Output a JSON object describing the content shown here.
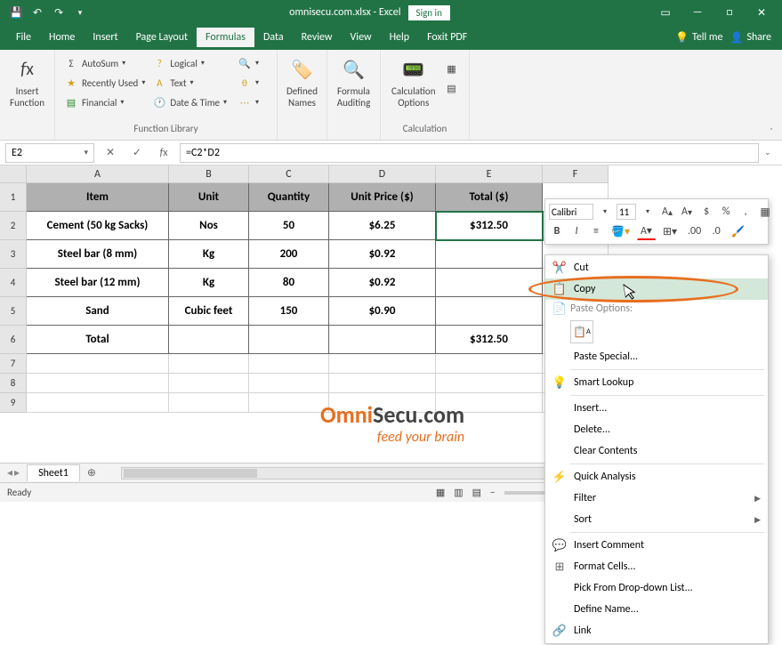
{
  "title": "omnisecu.com.xlsx - Excel",
  "signin": "Sign in",
  "tabs": [
    "File",
    "Home",
    "Insert",
    "Page Layout",
    "Formulas",
    "Data",
    "Review",
    "View",
    "Help",
    "Foxit PDF"
  ],
  "tellme": "Tell me",
  "share": "Share",
  "ribbon": {
    "insert_fn": "Insert\nFunction",
    "autosum": "AutoSum",
    "recent": "Recently Used",
    "financial": "Financial",
    "logical": "Logical",
    "text": "Text",
    "datetime": "Date & Time",
    "defnames": "Defined\nNames",
    "auditing": "Formula\nAuditing",
    "calcopt": "Calculation\nOptions",
    "group_lib": "Function Library",
    "group_calc": "Calculation"
  },
  "namebox": "E2",
  "formula": "=C2*D2",
  "cols": [
    "A",
    "B",
    "C",
    "D",
    "E",
    "F"
  ],
  "headers": [
    "Item",
    "Unit",
    "Quantity",
    "Unit Price ($)",
    "Total ($)"
  ],
  "rows": [
    {
      "item": "Cement (50 kg Sacks)",
      "unit": "Nos",
      "qty": "50",
      "price": "$6.25",
      "total": "$312.50"
    },
    {
      "item": "Steel bar (8 mm)",
      "unit": "Kg",
      "qty": "200",
      "price": "$0.92",
      "total": ""
    },
    {
      "item": "Steel bar (12 mm)",
      "unit": "Kg",
      "qty": "80",
      "price": "$0.92",
      "total": ""
    },
    {
      "item": "Sand",
      "unit": "Cubic feet",
      "qty": "150",
      "price": "$0.90",
      "total": ""
    },
    {
      "item": "Total",
      "unit": "",
      "qty": "",
      "price": "",
      "total": "$312.50"
    }
  ],
  "watermark": {
    "main": "Omni",
    "secu": "Secu.com",
    "sub": "feed your brain"
  },
  "sheet": "Sheet1",
  "status": "Ready",
  "mini": {
    "font": "Calibri",
    "size": "11"
  },
  "ctx": {
    "cut": "Cut",
    "copy": "Copy",
    "paste_options": "Paste Options:",
    "paste_special": "Paste Special...",
    "smart": "Smart Lookup",
    "insert": "Insert...",
    "delete": "Delete...",
    "clear": "Clear Contents",
    "quick": "Quick Analysis",
    "filter": "Filter",
    "sort": "Sort",
    "comment": "Insert Comment",
    "format": "Format Cells...",
    "pick": "Pick From Drop-down List...",
    "define": "Define Name...",
    "link": "Link"
  }
}
